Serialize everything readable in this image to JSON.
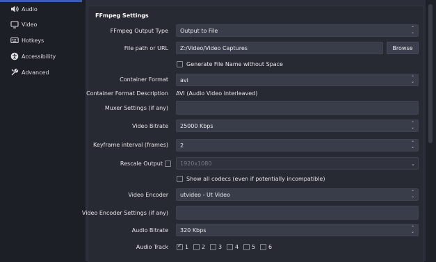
{
  "sidebar": {
    "items": [
      {
        "label": "Audio",
        "icon": "speaker-icon"
      },
      {
        "label": "Video",
        "icon": "monitor-icon"
      },
      {
        "label": "Hotkeys",
        "icon": "keyboard-icon"
      },
      {
        "label": "Accessibility",
        "icon": "accessibility-icon"
      },
      {
        "label": "Advanced",
        "icon": "wrench-icon"
      }
    ]
  },
  "ffmpeg": {
    "group_title": "FFmpeg Settings",
    "output_type": {
      "label": "FFmpeg Output Type",
      "value": "Output to File"
    },
    "file_path": {
      "label": "File path or URL",
      "value": "Z:/Video/Video Captures",
      "browse": "Browse"
    },
    "generate_name": {
      "label": "Generate File Name without Space",
      "checked": false
    },
    "container_format": {
      "label": "Container Format",
      "value": "avi"
    },
    "container_desc": {
      "label": "Container Format Description",
      "value": "AVI (Audio Video Interleaved)"
    },
    "muxer": {
      "label": "Muxer Settings (if any)",
      "value": ""
    },
    "video_bitrate": {
      "label": "Video Bitrate",
      "value": "25000 Kbps"
    },
    "keyframe": {
      "label": "Keyframe interval (frames)",
      "value": "2"
    },
    "rescale": {
      "label": "Rescale Output",
      "checked": false,
      "value": "1920x1080"
    },
    "show_all_codecs": {
      "label": "Show all codecs (even if potentially incompatible)",
      "checked": false
    },
    "video_encoder": {
      "label": "Video Encoder",
      "value": "utvideo - Ut Video"
    },
    "video_encoder_settings": {
      "label": "Video Encoder Settings (if any)",
      "value": ""
    },
    "audio_bitrate": {
      "label": "Audio Bitrate",
      "value": "320 Kbps"
    },
    "audio_track": {
      "label": "Audio Track",
      "tracks": [
        {
          "num": "1",
          "checked": true
        },
        {
          "num": "2",
          "checked": false
        },
        {
          "num": "3",
          "checked": false
        },
        {
          "num": "4",
          "checked": false
        },
        {
          "num": "5",
          "checked": false
        },
        {
          "num": "6",
          "checked": false
        }
      ]
    }
  }
}
